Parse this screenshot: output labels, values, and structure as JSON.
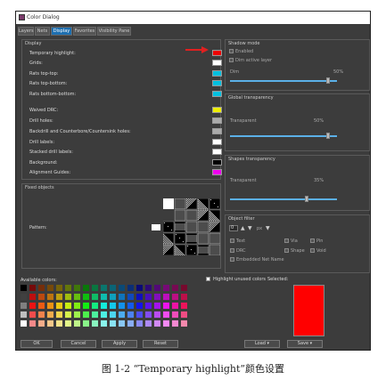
{
  "window": {
    "title": "Color Dialog"
  },
  "tabs": [
    {
      "label": "Layers"
    },
    {
      "label": "Nets"
    },
    {
      "label": "Display"
    },
    {
      "label": "Favorites"
    },
    {
      "label": "Visibility Pane"
    }
  ],
  "display": {
    "title": "Display",
    "items": [
      {
        "label": "Temporary highlight:",
        "color": "#ee0000"
      },
      {
        "label": "Grids:",
        "color": "#ffffff"
      },
      {
        "label": "Rats top-top:",
        "color": "#00c0e0"
      },
      {
        "label": "Rats top-bottom:",
        "color": "#00c0e0"
      },
      {
        "label": "Rats bottom-bottom:",
        "color": "#00c0e0"
      },
      {
        "label": "Waived DRC:",
        "color": "#eeee00"
      },
      {
        "label": "Drill holes:",
        "color": "#aaaaaa"
      },
      {
        "label": "Backdrill and Counterbore/Countersink holes:",
        "color": "#aaaaaa"
      },
      {
        "label": "Drill labels:",
        "color": "#ffffff"
      },
      {
        "label": "Stacked drill labels:",
        "color": "#ffffff"
      },
      {
        "label": "Background:",
        "color": "#000000"
      },
      {
        "label": "Alignment Guides:",
        "color": "#ee00ee"
      }
    ]
  },
  "fixed": {
    "title": "Fixed objects",
    "pattern_label": "Pattern:"
  },
  "shadow": {
    "title": "Shadow mode",
    "enabled": "Enabled",
    "dim_active": "Dim active layer",
    "dim_label": "Dim",
    "dim_value": "50%",
    "dim_level": 0.9
  },
  "transparency": {
    "title": "Global transparency",
    "label": "Transparent",
    "value": "50%",
    "level": 0.9
  },
  "shapes": {
    "title": "Shapes transparency",
    "label": "Transparent",
    "value": "35%",
    "level": 0.7
  },
  "objfilter": {
    "title": "Object filter",
    "input": "0",
    "unit": "px",
    "items": [
      {
        "label": "Text"
      },
      {
        "label": "Via"
      },
      {
        "label": "Pin"
      },
      {
        "label": "DRC"
      },
      {
        "label": "Shape"
      },
      {
        "label": "Void"
      },
      {
        "label": "Embedded Net Name"
      }
    ]
  },
  "palette": {
    "available": "Available colors:",
    "highlight_unused": "Highlight unused colors",
    "selected": "Selected:",
    "selected_color": "#ff0000"
  },
  "buttons": {
    "ok": "OK",
    "cancel": "Cancel",
    "apply": "Apply",
    "reset": "Reset",
    "load": "Load",
    "save": "Save"
  },
  "caption": {
    "text": "图 1-2 “Temporary highlight”颜色设置"
  }
}
